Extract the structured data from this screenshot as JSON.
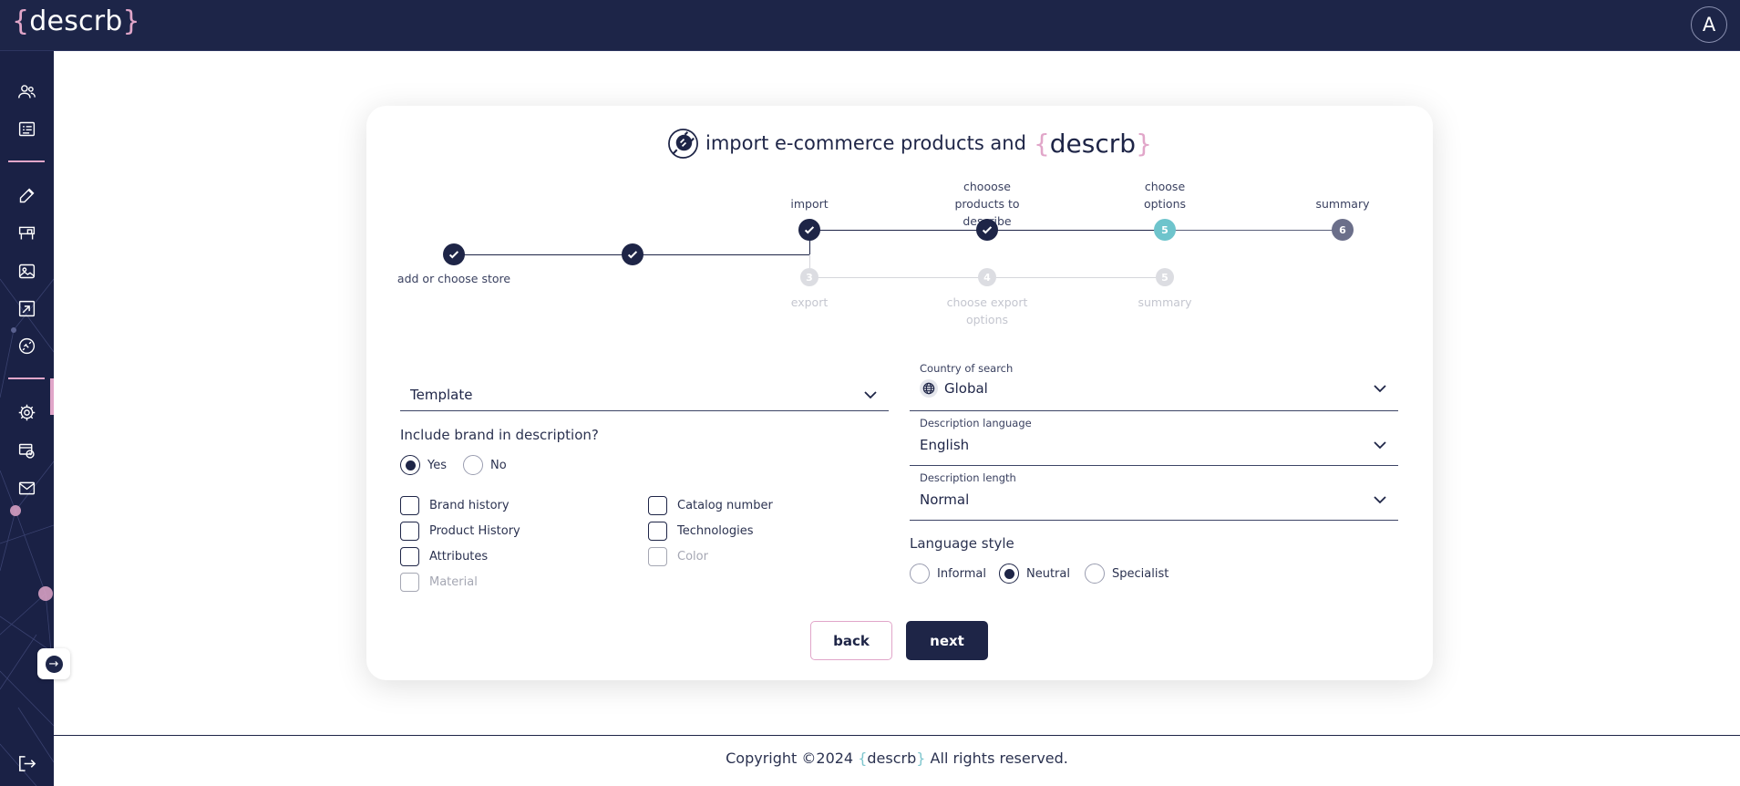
{
  "app": {
    "logo": {
      "open": "{",
      "name": "descrb",
      "close": "}"
    },
    "avatar_initial": "A"
  },
  "sidebar": {
    "items": [
      {
        "icon": "users-icon"
      },
      {
        "icon": "list-icon"
      },
      {
        "icon": "edit-icon"
      },
      {
        "icon": "desk-icon"
      },
      {
        "icon": "image-icon"
      },
      {
        "icon": "export-icon"
      },
      {
        "icon": "plug-icon",
        "active": true
      },
      {
        "icon": "gear-icon"
      },
      {
        "icon": "billing-icon"
      },
      {
        "icon": "mail-icon"
      }
    ],
    "expand_icon": "→",
    "logout_icon": "logout-icon"
  },
  "card": {
    "title": "import e-commerce products and",
    "title_brand": {
      "open": "{",
      "name": "descrb",
      "close": "}"
    },
    "stepper": {
      "top": [
        {
          "label": "add or choose store",
          "state": "done"
        },
        {
          "label": "",
          "state": "done"
        },
        {
          "label": "import",
          "state": "done"
        },
        {
          "label": "chooose products to describe",
          "state": "done"
        },
        {
          "label": "choose options",
          "number": "5",
          "state": "current"
        },
        {
          "label": "summary",
          "number": "6",
          "state": "upcoming"
        }
      ],
      "bottom": [
        {
          "label": "export",
          "number": "3"
        },
        {
          "label": "choose export options",
          "number": "4"
        },
        {
          "label": "summary",
          "number": "5"
        }
      ]
    },
    "template": {
      "placeholder": "Template"
    },
    "include_brand": {
      "question": "Include brand in description?",
      "yes": "Yes",
      "no": "No",
      "selected": "Yes"
    },
    "checkboxes": [
      {
        "label": "Brand history",
        "checked": false,
        "disabled": false
      },
      {
        "label": "Catalog number",
        "checked": false,
        "disabled": false
      },
      {
        "label": "Product History",
        "checked": false,
        "disabled": false
      },
      {
        "label": "Technologies",
        "checked": false,
        "disabled": false
      },
      {
        "label": "Attributes",
        "checked": false,
        "disabled": false
      },
      {
        "label": "Color",
        "checked": false,
        "disabled": true
      },
      {
        "label": "Material",
        "checked": false,
        "disabled": true
      }
    ],
    "country": {
      "caption": "Country of search",
      "value": "Global"
    },
    "language": {
      "caption": "Description language",
      "value": "English"
    },
    "length": {
      "caption": "Description length",
      "value": "Normal"
    },
    "language_style": {
      "label": "Language style",
      "options": [
        "Informal",
        "Neutral",
        "Specialist"
      ],
      "selected": "Neutral"
    },
    "buttons": {
      "back": "back",
      "next": "next"
    }
  },
  "footer": {
    "prefix": "Copyright ©2024",
    "brand": {
      "open": "{",
      "name": "descrb",
      "close": "}"
    },
    "suffix": "All rights reserved."
  },
  "colors": {
    "navy": "#1d2548",
    "pink": "#e1a6c9",
    "teal": "#6ec4cc"
  }
}
